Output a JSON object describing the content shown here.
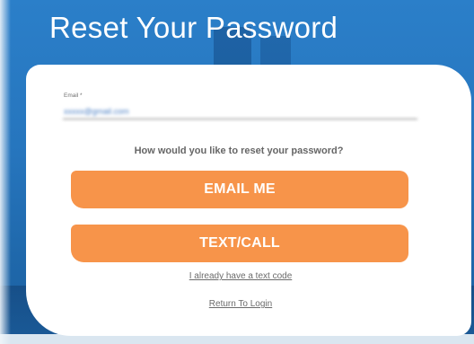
{
  "page": {
    "title": "Reset Your Password"
  },
  "form": {
    "email_label": "Email *",
    "email_value": "xxxxx@gmail.com",
    "question": "How would you like to reset your password?",
    "email_button": "EMAIL ME",
    "text_button": "TEXT/CALL",
    "code_link": "I already have a text code",
    "login_link": "Return To Login"
  },
  "colors": {
    "background": "#2675bd",
    "card": "#ffffff",
    "button": "#f7944a",
    "button_text": "#ffffff",
    "link_text": "#6b6b6b"
  }
}
